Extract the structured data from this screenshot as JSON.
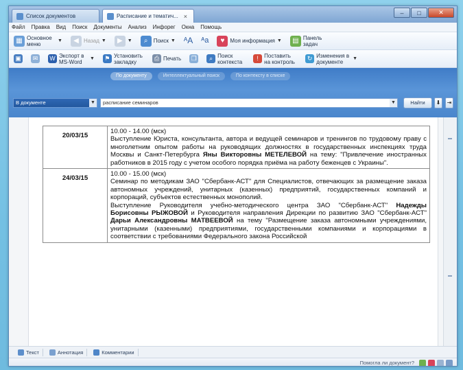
{
  "tabs": [
    {
      "label": "Список документов",
      "active": false
    },
    {
      "label": "Расписание и тематич...",
      "active": true
    }
  ],
  "window_controls": {
    "minimize": "–",
    "maximize": "□",
    "close": "✕"
  },
  "menu": [
    "Файл",
    "Правка",
    "Вид",
    "Поиск",
    "Документы",
    "Анализ",
    "Инфорег",
    "Окна",
    "Помощь"
  ],
  "toolbar1": {
    "main_menu": "Основное меню",
    "back": "Назад",
    "search": "Поиск",
    "my_info": "Моя информация",
    "legal_tasks": "Панель задач"
  },
  "toolbar2": {
    "export": "Экспорт в MS-Word",
    "bookmark": "Установить закладку",
    "print": "Печать",
    "context_search": "Поиск контекста",
    "control": "Поставить на контроль",
    "changes": "Изменения в документе"
  },
  "search": {
    "modes": [
      "По документу",
      "Интеллектуальный поиск",
      "По контексту в списке"
    ],
    "scope": "В документе",
    "query": "расписание семинаров",
    "find_label": "Найти"
  },
  "schedule": [
    {
      "date": "20/03/15",
      "time": "10.00 - 14.00 (мск)",
      "text_before": "Выступление Юриста, консультанта, автора и ведущей семинаров и тренингов по трудовому праву с многолетним опытом работы на руководящих должностях в государственных инспекциях труда Москвы и Санкт-Петербурга ",
      "name": "Яны Викторовны МЕТЕЛЕВОЙ",
      "text_after": " на тему: \"Привлечение иностранных работников в 2015 году с учетом особого порядка приёма на работу беженцев с Украины\"."
    },
    {
      "date": "24/03/15",
      "time": "10.00 - 15.00 (мск)",
      "seminar": "Семинар по методикам ЗАО \"Сбербанк-АСТ\" для Специалистов, отвечающих за размещение заказа автономных учреждений, унитарных (казенных) предприятий, государственных компаний и корпораций, субъектов естественных монополий.",
      "speech_1": "Выступление Руководителя учебно-методического центра ЗАО \"Сбербанк-АСТ\" ",
      "name_1": "Надежды Борисовны РЫЖОВОЙ",
      "speech_2": " и Руководителя направления Дирекции по развитию ЗАО \"Сбербанк-АСТ\" ",
      "name_2": "Дарьи Александровны МАТВЕЕВОЙ",
      "speech_3": " на тему \"Размещение заказа автономными учреждениями, унитарными (казенными) предприятиями, государственными компаниями и корпорациями в соответствии с требованиями Федерального закона Российской"
    }
  ],
  "bottom_tabs": [
    "Текст",
    "Аннотация",
    "Комментарии"
  ],
  "status": {
    "question": "Помогла ли документ?"
  },
  "colors": {
    "search_panel": "#4a86cc",
    "page_bg": "#7ec7e6"
  }
}
